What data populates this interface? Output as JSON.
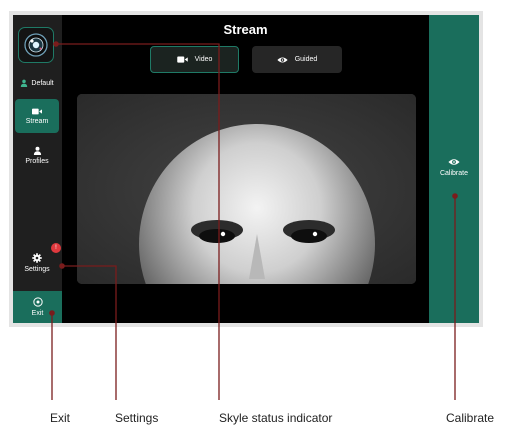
{
  "header": {
    "title": "Stream"
  },
  "sidebar": {
    "items": [
      {
        "id": "default",
        "label": "Default",
        "icon": "user-icon"
      },
      {
        "id": "stream",
        "label": "Stream",
        "icon": "video-camera-icon",
        "active": true
      },
      {
        "id": "profiles",
        "label": "Profiles",
        "icon": "user-icon"
      },
      {
        "id": "settings",
        "label": "Settings",
        "icon": "gear-icon",
        "badge": "!"
      },
      {
        "id": "exit",
        "label": "Exit",
        "icon": "power-icon"
      }
    ]
  },
  "tabs": [
    {
      "id": "video",
      "label": "Video",
      "icon": "video-camera-icon",
      "active": true
    },
    {
      "id": "guided",
      "label": "Guided",
      "icon": "eye-icon"
    }
  ],
  "calibrate": {
    "label": "Calibrate",
    "icon": "eye-icon"
  },
  "annotations": {
    "exit": "Exit",
    "settings": "Settings",
    "status": "Skyle status indicator",
    "calibrate": "Calibrate"
  },
  "colors": {
    "accent": "#1a6e5c",
    "sidebar_bg": "#1f1f1f",
    "app_bg": "#000000",
    "badge": "#e0393e",
    "callout_line": "#7a1c1c"
  }
}
